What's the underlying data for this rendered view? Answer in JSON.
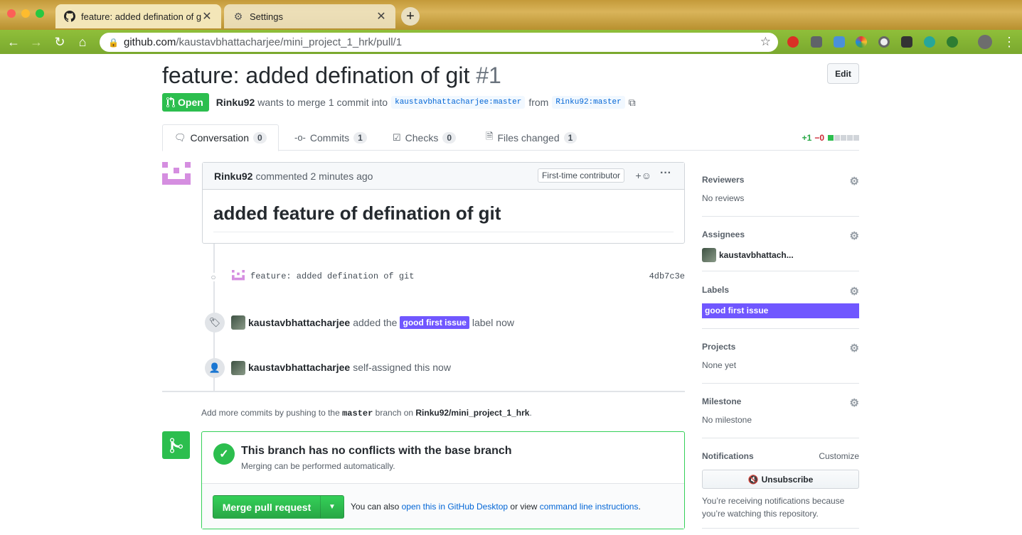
{
  "browser": {
    "tabs": [
      {
        "title": "feature: added defination of git",
        "active": true
      },
      {
        "title": "Settings",
        "active": false
      }
    ],
    "url_host": "github.com",
    "url_path": "/kaustavbhattacharjee/mini_project_1_hrk/pull/1"
  },
  "pr": {
    "title": "feature: added defination of git",
    "number": "#1",
    "edit_label": "Edit",
    "state": "Open",
    "author": "Rinku92",
    "merge_text": "wants to merge 1 commit into",
    "base_branch": "kaustavbhattacharjee:master",
    "from_text": "from",
    "head_branch": "Rinku92:master"
  },
  "tabs": [
    {
      "label": "Conversation",
      "count": "0"
    },
    {
      "label": "Commits",
      "count": "1"
    },
    {
      "label": "Checks",
      "count": "0"
    },
    {
      "label": "Files changed",
      "count": "1"
    }
  ],
  "diffstat": {
    "additions": "+1",
    "deletions": "−0"
  },
  "comment": {
    "author": "Rinku92",
    "time": "commented 2 minutes ago",
    "badge": "First-time contributor",
    "react": "+☺",
    "more": "···",
    "body": "added feature of defination of git"
  },
  "commit": {
    "message": "feature: added defination of git",
    "sha": "4db7c3e"
  },
  "events": [
    {
      "actor": "kaustavbhattacharjee",
      "pre": "added the",
      "label": "good first issue",
      "post": "label now"
    },
    {
      "actor": "kaustavbhattacharjee",
      "text": "self-assigned this now"
    }
  ],
  "hint": {
    "pre": "Add more commits by pushing to the",
    "branch": "master",
    "mid": "branch on",
    "repo": "Rinku92/mini_project_1_hrk",
    "end": "."
  },
  "merge": {
    "title": "This branch has no conflicts with the base branch",
    "subtitle": "Merging can be performed automatically.",
    "button": "Merge pull request",
    "also_pre": "You can also",
    "link1": "open this in GitHub Desktop",
    "also_mid": "or view",
    "link2": "command line instructions",
    "also_end": "."
  },
  "sidebar": {
    "reviewers": {
      "title": "Reviewers",
      "value": "No reviews"
    },
    "assignees": {
      "title": "Assignees",
      "value": "kaustavbhattach..."
    },
    "labels": {
      "title": "Labels",
      "value": "good first issue"
    },
    "projects": {
      "title": "Projects",
      "value": "None yet"
    },
    "milestone": {
      "title": "Milestone",
      "value": "No milestone"
    },
    "notifications": {
      "title": "Notifications",
      "customize": "Customize",
      "button": "Unsubscribe",
      "notice": "You’re receiving notifications because you’re watching this repository."
    }
  },
  "colors": {
    "open": "#2cbe4e",
    "label": "#7057ff",
    "link": "#0366d6"
  }
}
